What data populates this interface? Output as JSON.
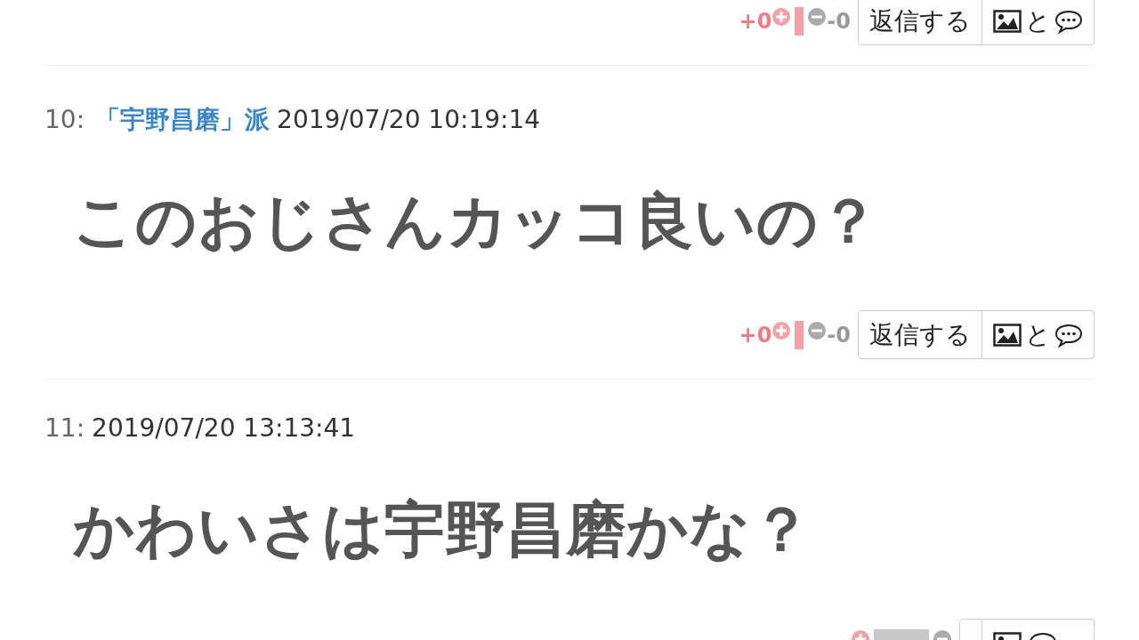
{
  "posts": [
    {
      "actions": {
        "plus": "+0",
        "minus": "-0",
        "kind": "even",
        "reply": "返信する",
        "with": "と"
      }
    },
    {
      "number": "10:",
      "name": "「宇野昌磨」派",
      "date": "2019/07/20 10:19:14",
      "body": "このおじさんカッコ良いの？",
      "actions": {
        "plus": "+0",
        "minus": "-0",
        "kind": "even",
        "reply": "返信する",
        "with": "と"
      }
    },
    {
      "number": "11:",
      "date": "2019/07/20 13:13:41",
      "body": "かわいさは宇野昌磨かな？",
      "actions": {
        "kind": "minus"
      }
    }
  ]
}
